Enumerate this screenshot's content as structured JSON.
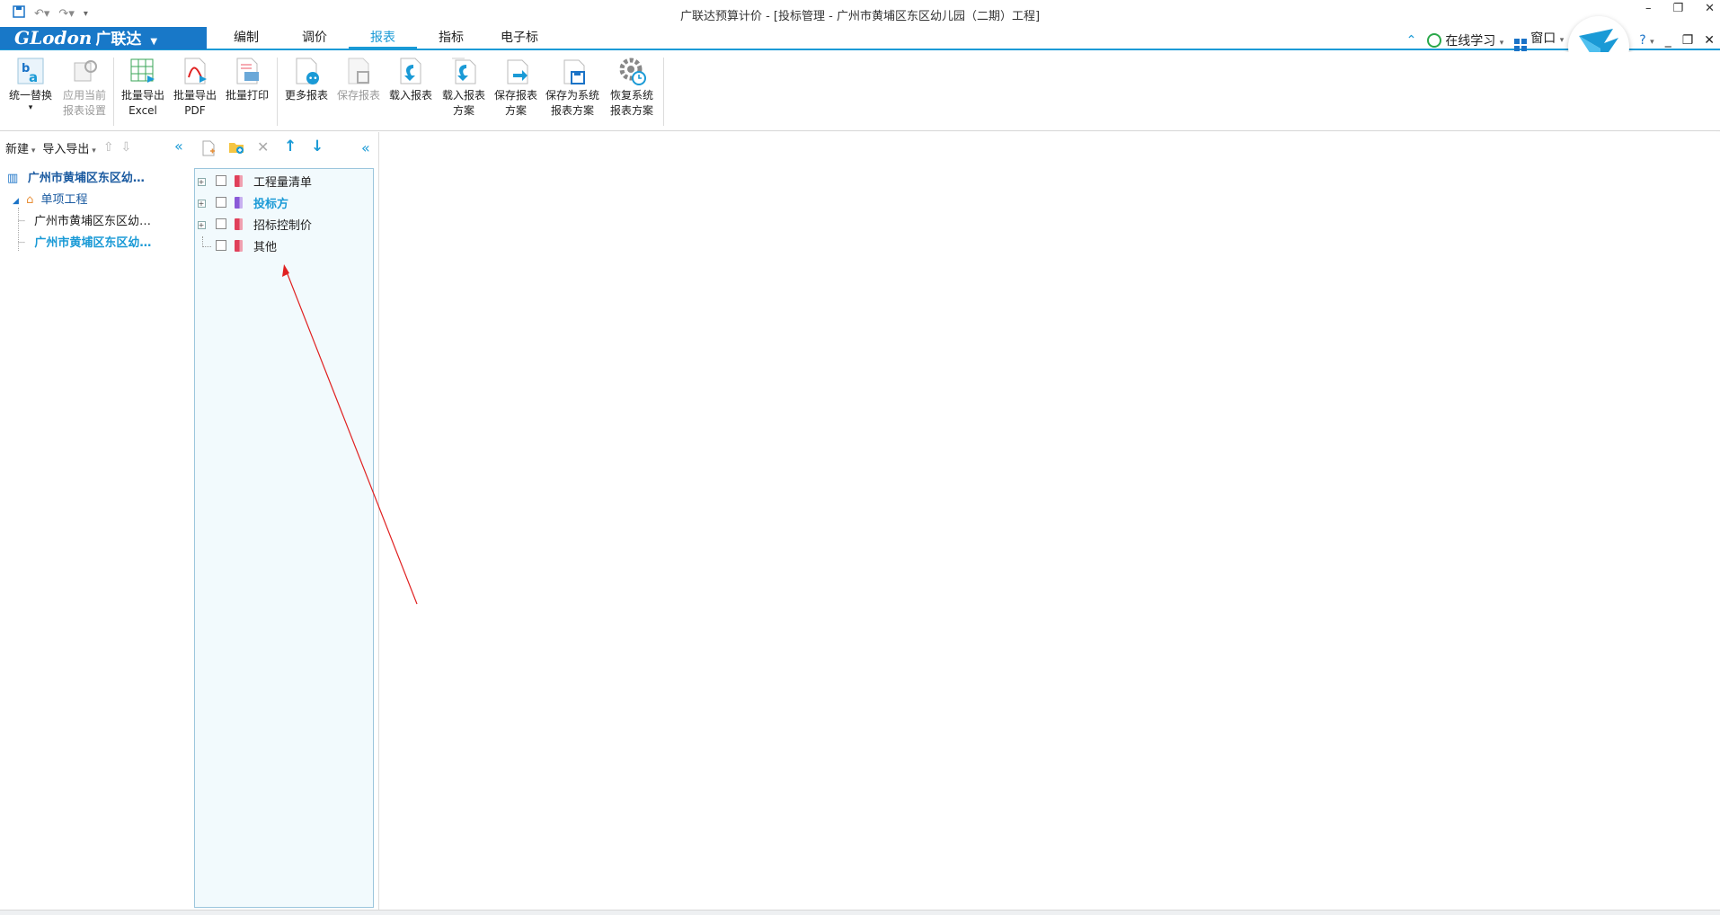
{
  "window": {
    "title": "广联达预算计价 - [投标管理 - 广州市黄埔区东区幼儿园（二期）工程]",
    "controls": [
      "–",
      "❐",
      "✕"
    ]
  },
  "logo": {
    "brand": "GLodon",
    "cn": "广联达"
  },
  "menu": {
    "tabs": [
      {
        "label": "编制"
      },
      {
        "label": "调价"
      },
      {
        "label": "报表"
      },
      {
        "label": "指标"
      },
      {
        "label": "电子标"
      }
    ],
    "active_tab": "报表",
    "online_learning": "在线学习",
    "window_menu": "窗口",
    "help": "?"
  },
  "ribbon": {
    "buttons": [
      {
        "l1": "统一替换",
        "l2": "▾",
        "disabled": false
      },
      {
        "l1": "应用当前",
        "l2": "报表设置",
        "disabled": true
      },
      {
        "l1": "批量导出",
        "l2": "Excel",
        "disabled": false
      },
      {
        "l1": "批量导出",
        "l2": "PDF",
        "disabled": false
      },
      {
        "l1": "批量打印",
        "l2": "",
        "disabled": false
      },
      {
        "l1": "更多报表",
        "l2": "",
        "disabled": false
      },
      {
        "l1": "保存报表",
        "l2": "",
        "disabled": true
      },
      {
        "l1": "载入报表",
        "l2": "",
        "disabled": false
      },
      {
        "l1": "载入报表",
        "l2": "方案",
        "disabled": false
      },
      {
        "l1": "保存报表",
        "l2": "方案",
        "disabled": false
      },
      {
        "l1": "保存为系统",
        "l2": "报表方案",
        "disabled": false
      },
      {
        "l1": "恢复系统",
        "l2": "报表方案",
        "disabled": false
      }
    ]
  },
  "left_panel": {
    "new_label": "新建",
    "import_export_label": "导入导出",
    "tree": [
      {
        "label": "广州市黄埔区东区幼…",
        "level": 0
      },
      {
        "label": "单项工程",
        "level": 1
      },
      {
        "label": "广州市黄埔区东区幼…",
        "level": 2
      },
      {
        "label": "广州市黄埔区东区幼…",
        "level": 2
      }
    ]
  },
  "report_tree": {
    "items": [
      {
        "label": "工程量清单",
        "expandable": true,
        "selected": false
      },
      {
        "label": "投标方",
        "expandable": true,
        "selected": true
      },
      {
        "label": "招标控制价",
        "expandable": true,
        "selected": false
      },
      {
        "label": "其他",
        "expandable": false,
        "selected": false
      }
    ]
  },
  "colors": {
    "accent": "#1a9ad6",
    "brand": "#1878c8",
    "tree_bg": "#f2fafd",
    "annotation": "#e02020"
  }
}
